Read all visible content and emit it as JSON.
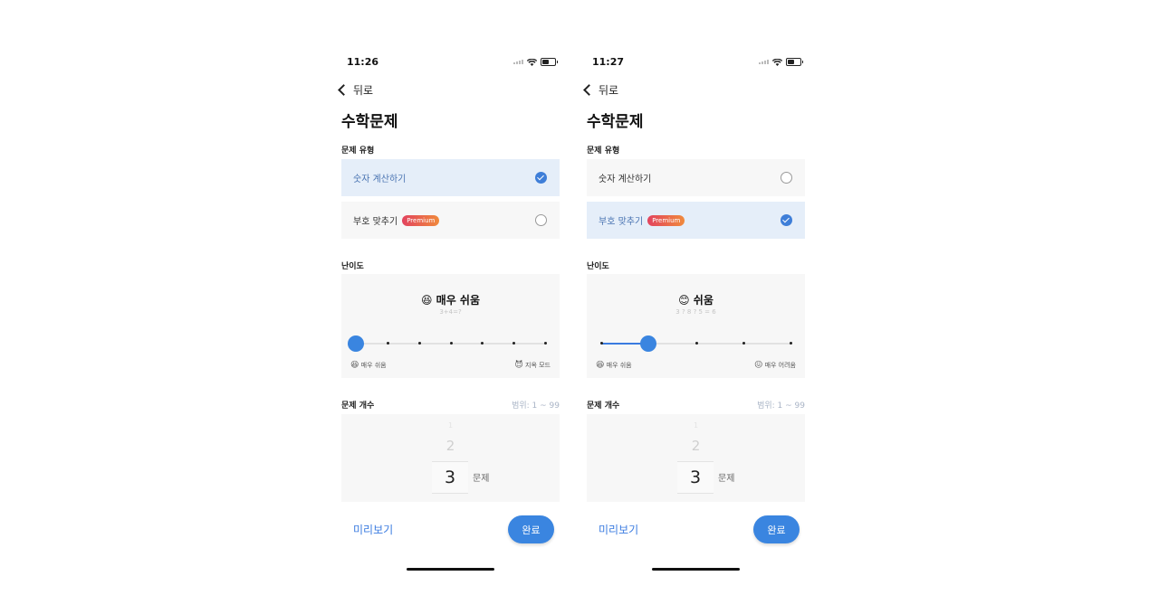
{
  "left": {
    "status": {
      "time": "11:26"
    },
    "back_label": "뒤로",
    "title": "수학문제",
    "type_section": "문제 유형",
    "options": [
      {
        "label": "숫자 계산하기",
        "badge": "",
        "selected": true
      },
      {
        "label": "부호 맞추기",
        "badge": "Premium",
        "selected": false
      }
    ],
    "difficulty_section": "난이도",
    "difficulty": {
      "emoji": "😆",
      "title": "매우 쉬움",
      "example": "3+4=?",
      "slider_value": 0,
      "slider_max": 6,
      "min_emoji": "😆",
      "min_label": "매우 쉬움",
      "max_emoji": "😈",
      "max_label": "지옥 모드"
    },
    "count_section": "문제 개수",
    "count_range": "범위: 1 ~ 99",
    "picker": {
      "prev2": "1",
      "prev1": "2",
      "value": "3",
      "unit": "문제"
    },
    "preview_label": "미리보기",
    "done_label": "완료"
  },
  "right": {
    "status": {
      "time": "11:27"
    },
    "back_label": "뒤로",
    "title": "수학문제",
    "type_section": "문제 유형",
    "options": [
      {
        "label": "숫자 계산하기",
        "badge": "",
        "selected": false
      },
      {
        "label": "부호 맞추기",
        "badge": "Premium",
        "selected": true
      }
    ],
    "difficulty_section": "난이도",
    "difficulty": {
      "emoji": "😊",
      "title": "쉬움",
      "example": "3 ? 8 ? 5 = 6",
      "slider_value": 1,
      "slider_max": 4,
      "min_emoji": "😆",
      "min_label": "매우 쉬움",
      "max_emoji": "😖",
      "max_label": "매우 어려움"
    },
    "count_section": "문제 개수",
    "count_range": "범위: 1 ~ 99",
    "picker": {
      "prev2": "1",
      "prev1": "2",
      "value": "3",
      "unit": "문제"
    },
    "preview_label": "미리보기",
    "done_label": "완료"
  },
  "colors": {
    "accent": "#3a85e0",
    "selected_bg": "#e5eef9",
    "card_bg": "#f7f7f7"
  },
  "icons": [
    "chevron-left-icon",
    "signal-icon",
    "wifi-icon",
    "battery-icon",
    "check-icon",
    "emoji-icon"
  ]
}
